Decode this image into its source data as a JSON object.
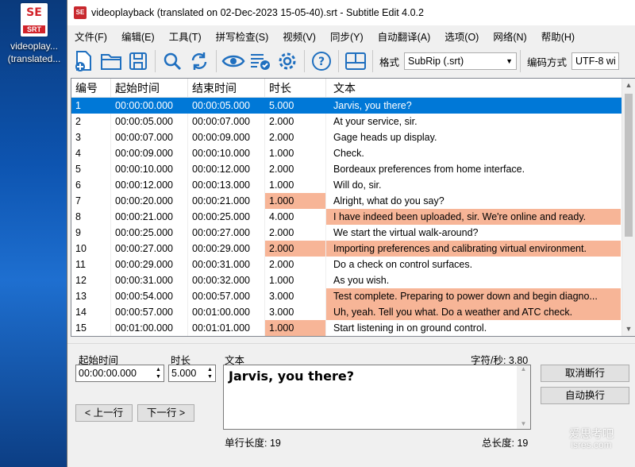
{
  "desktop": {
    "icon_name": "srt-file-icon",
    "icon_logo": "SE",
    "icon_badge": "SRT",
    "label_line1": "videoplay...",
    "label_line2": "(translated..."
  },
  "window": {
    "title": "videoplayback (translated on 02-Dec-2023 15-05-40).srt - Subtitle Edit 4.0.2",
    "app_icon_text": "SE"
  },
  "menu": [
    "文件(F)",
    "编辑(E)",
    "工具(T)",
    "拼写检查(S)",
    "视频(V)",
    "同步(Y)",
    "自动翻译(A)",
    "选项(O)",
    "网络(N)",
    "帮助(H)"
  ],
  "toolbar": {
    "buttons": [
      "new-file-icon",
      "open-folder-icon",
      "save-icon",
      "search-icon",
      "replace-icon",
      "eye-icon",
      "spellcheck-icon",
      "settings-icon",
      "help-icon",
      "layout-icon"
    ],
    "format_label": "格式",
    "format_value": "SubRip (.srt)",
    "encoding_label": "编码方式",
    "encoding_value": "UTF-8 wi"
  },
  "grid": {
    "headers": [
      "编号",
      "起始时间",
      "结束时间",
      "时长",
      "文本"
    ],
    "rows": [
      {
        "num": "1",
        "start": "00:00:00.000",
        "end": "00:00:05.000",
        "dur": "5.000",
        "text": "Jarvis, you there?",
        "selected": true,
        "dur_hl": false,
        "text_hl": false
      },
      {
        "num": "2",
        "start": "00:00:05.000",
        "end": "00:00:07.000",
        "dur": "2.000",
        "text": "At your service, sir.",
        "selected": false,
        "dur_hl": false,
        "text_hl": false
      },
      {
        "num": "3",
        "start": "00:00:07.000",
        "end": "00:00:09.000",
        "dur": "2.000",
        "text": "Gage heads up display.",
        "selected": false,
        "dur_hl": false,
        "text_hl": false
      },
      {
        "num": "4",
        "start": "00:00:09.000",
        "end": "00:00:10.000",
        "dur": "1.000",
        "text": "Check.",
        "selected": false,
        "dur_hl": false,
        "text_hl": false
      },
      {
        "num": "5",
        "start": "00:00:10.000",
        "end": "00:00:12.000",
        "dur": "2.000",
        "text": "Bordeaux preferences from home interface.",
        "selected": false,
        "dur_hl": false,
        "text_hl": false
      },
      {
        "num": "6",
        "start": "00:00:12.000",
        "end": "00:00:13.000",
        "dur": "1.000",
        "text": "Will do, sir.",
        "selected": false,
        "dur_hl": false,
        "text_hl": false
      },
      {
        "num": "7",
        "start": "00:00:20.000",
        "end": "00:00:21.000",
        "dur": "1.000",
        "text": "Alright, what do you say?",
        "selected": false,
        "dur_hl": true,
        "text_hl": false
      },
      {
        "num": "8",
        "start": "00:00:21.000",
        "end": "00:00:25.000",
        "dur": "4.000",
        "text": "I have indeed been uploaded, sir. We're online and ready.",
        "selected": false,
        "dur_hl": false,
        "text_hl": true
      },
      {
        "num": "9",
        "start": "00:00:25.000",
        "end": "00:00:27.000",
        "dur": "2.000",
        "text": "We start the virtual walk-around?",
        "selected": false,
        "dur_hl": false,
        "text_hl": false
      },
      {
        "num": "10",
        "start": "00:00:27.000",
        "end": "00:00:29.000",
        "dur": "2.000",
        "text": "Importing preferences and calibrating virtual environment.",
        "selected": false,
        "dur_hl": true,
        "text_hl": true
      },
      {
        "num": "11",
        "start": "00:00:29.000",
        "end": "00:00:31.000",
        "dur": "2.000",
        "text": "Do a check on control surfaces.",
        "selected": false,
        "dur_hl": false,
        "text_hl": false
      },
      {
        "num": "12",
        "start": "00:00:31.000",
        "end": "00:00:32.000",
        "dur": "1.000",
        "text": "As you wish.",
        "selected": false,
        "dur_hl": false,
        "text_hl": false
      },
      {
        "num": "13",
        "start": "00:00:54.000",
        "end": "00:00:57.000",
        "dur": "3.000",
        "text": "Test complete. Preparing to power down and begin diagno...",
        "selected": false,
        "dur_hl": false,
        "text_hl": true
      },
      {
        "num": "14",
        "start": "00:00:57.000",
        "end": "00:01:00.000",
        "dur": "3.000",
        "text": "Uh, yeah. Tell you what. Do a weather and ATC check.",
        "selected": false,
        "dur_hl": false,
        "text_hl": true
      },
      {
        "num": "15",
        "start": "00:01:00.000",
        "end": "00:01:01.000",
        "dur": "1.000",
        "text": "Start listening in on ground control.",
        "selected": false,
        "dur_hl": true,
        "text_hl": false
      }
    ]
  },
  "editor": {
    "start_label": "起始时间",
    "start_value": "00:00:00.000",
    "duration_label": "时长",
    "duration_value": "5.000",
    "text_label": "文本",
    "cps_label": "字符/秒: 3.80",
    "text_value": "Jarvis, you there?",
    "prev_button": "< 上一行",
    "next_button": "下一行 >",
    "unbreak_button": "取消断行",
    "auto_break_button": "自动换行",
    "single_line_length": "单行长度: 19",
    "total_length": "总长度: 19"
  },
  "watermark": {
    "line1": "爱思考吧",
    "line2": "isres.com"
  },
  "colors": {
    "selection": "#0078d7",
    "highlight": "#f7b597",
    "brand_red": "#c8282e",
    "icon_blue": "#1f6fbf"
  }
}
